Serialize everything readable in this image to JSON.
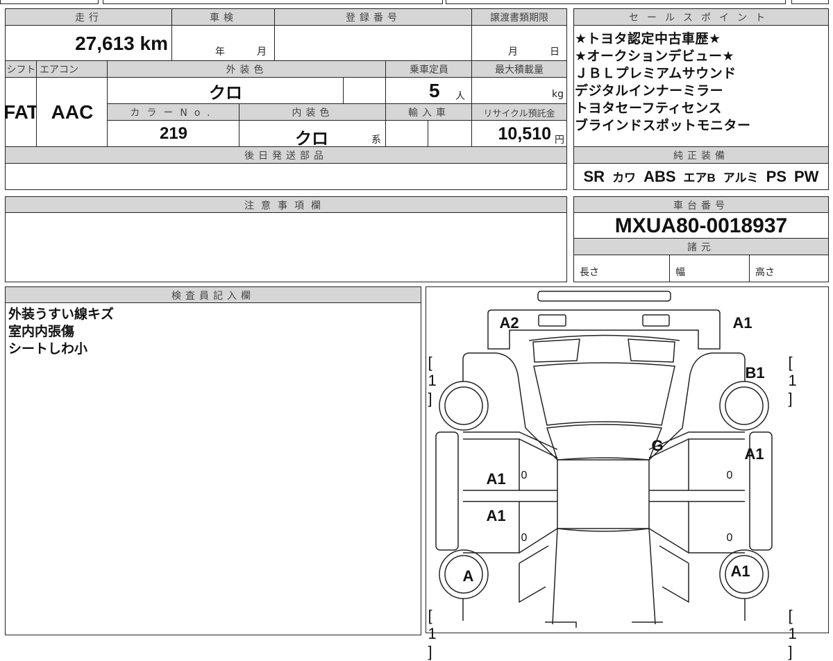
{
  "top_table": {
    "mileage_label": "走行",
    "mileage": "27,613",
    "mileage_unit": "km",
    "shaken_label": "車検",
    "shaken_year": "年",
    "shaken_month": "月",
    "reg_label": "登録番号",
    "transfer_label": "譲渡書類期限",
    "transfer_month": "月",
    "transfer_day": "日",
    "shift_label": "シフト",
    "shift": "FAT",
    "ac_label": "エアコン",
    "ac": "AAC",
    "ext_color_label": "外装色",
    "ext_color": "クロ",
    "capacity_label": "乗車定員",
    "capacity": "5",
    "capacity_unit": "人",
    "max_load_label": "最大積載量",
    "max_load_unit": "kg",
    "color_no_label": "カラーNo.",
    "color_no": "219",
    "int_color_label": "内装色",
    "int_color": "クロ",
    "int_color_suffix": "系",
    "import_label": "輸入車",
    "recycle_label": "リサイクル預託金",
    "recycle": "10,510",
    "recycle_unit": "円",
    "later_parts_label": "後日発送部品"
  },
  "sales_points": {
    "label": "セールスポイント",
    "lines": [
      "★トヨタ認定中古車歴★",
      "★オークションデビュー★",
      "ＪＢＬプレミアムサウンド",
      "デジタルインナーミラー",
      "トヨタセーフティセンス",
      "ブラインドスポットモニター"
    ]
  },
  "equipment": {
    "label": "純正装備",
    "items": [
      "SR",
      "カワ",
      "ABS",
      "エアB",
      "アルミ",
      "PS",
      "PW"
    ]
  },
  "notes": {
    "label": "注意事項欄"
  },
  "chassis": {
    "label": "車台番号",
    "number": "MXUA80-0018937",
    "specs_label": "諸元",
    "length_label": "長さ",
    "width_label": "幅",
    "height_label": "高さ"
  },
  "inspector": {
    "label": "検査員記入欄",
    "lines": [
      "外装うすい線キズ",
      "室内内張傷",
      "シートしわ小"
    ]
  },
  "diagram": {
    "front_left": "A2",
    "front_right": "A1",
    "bracket_fl": "[ 1 ]",
    "bracket_fr": "[ 1 ]",
    "bracket_rl": "[ 1 ]",
    "bracket_rr": "[ 1 ]",
    "fender_right": "B1",
    "windshield": "G",
    "right_front_door": "A1",
    "left_front_door": "A1",
    "left_rear_door": "A1",
    "left_rear_wheel": "A",
    "right_rear_fender": "A1",
    "door_marks": [
      "0",
      "0",
      "0",
      "0"
    ]
  }
}
